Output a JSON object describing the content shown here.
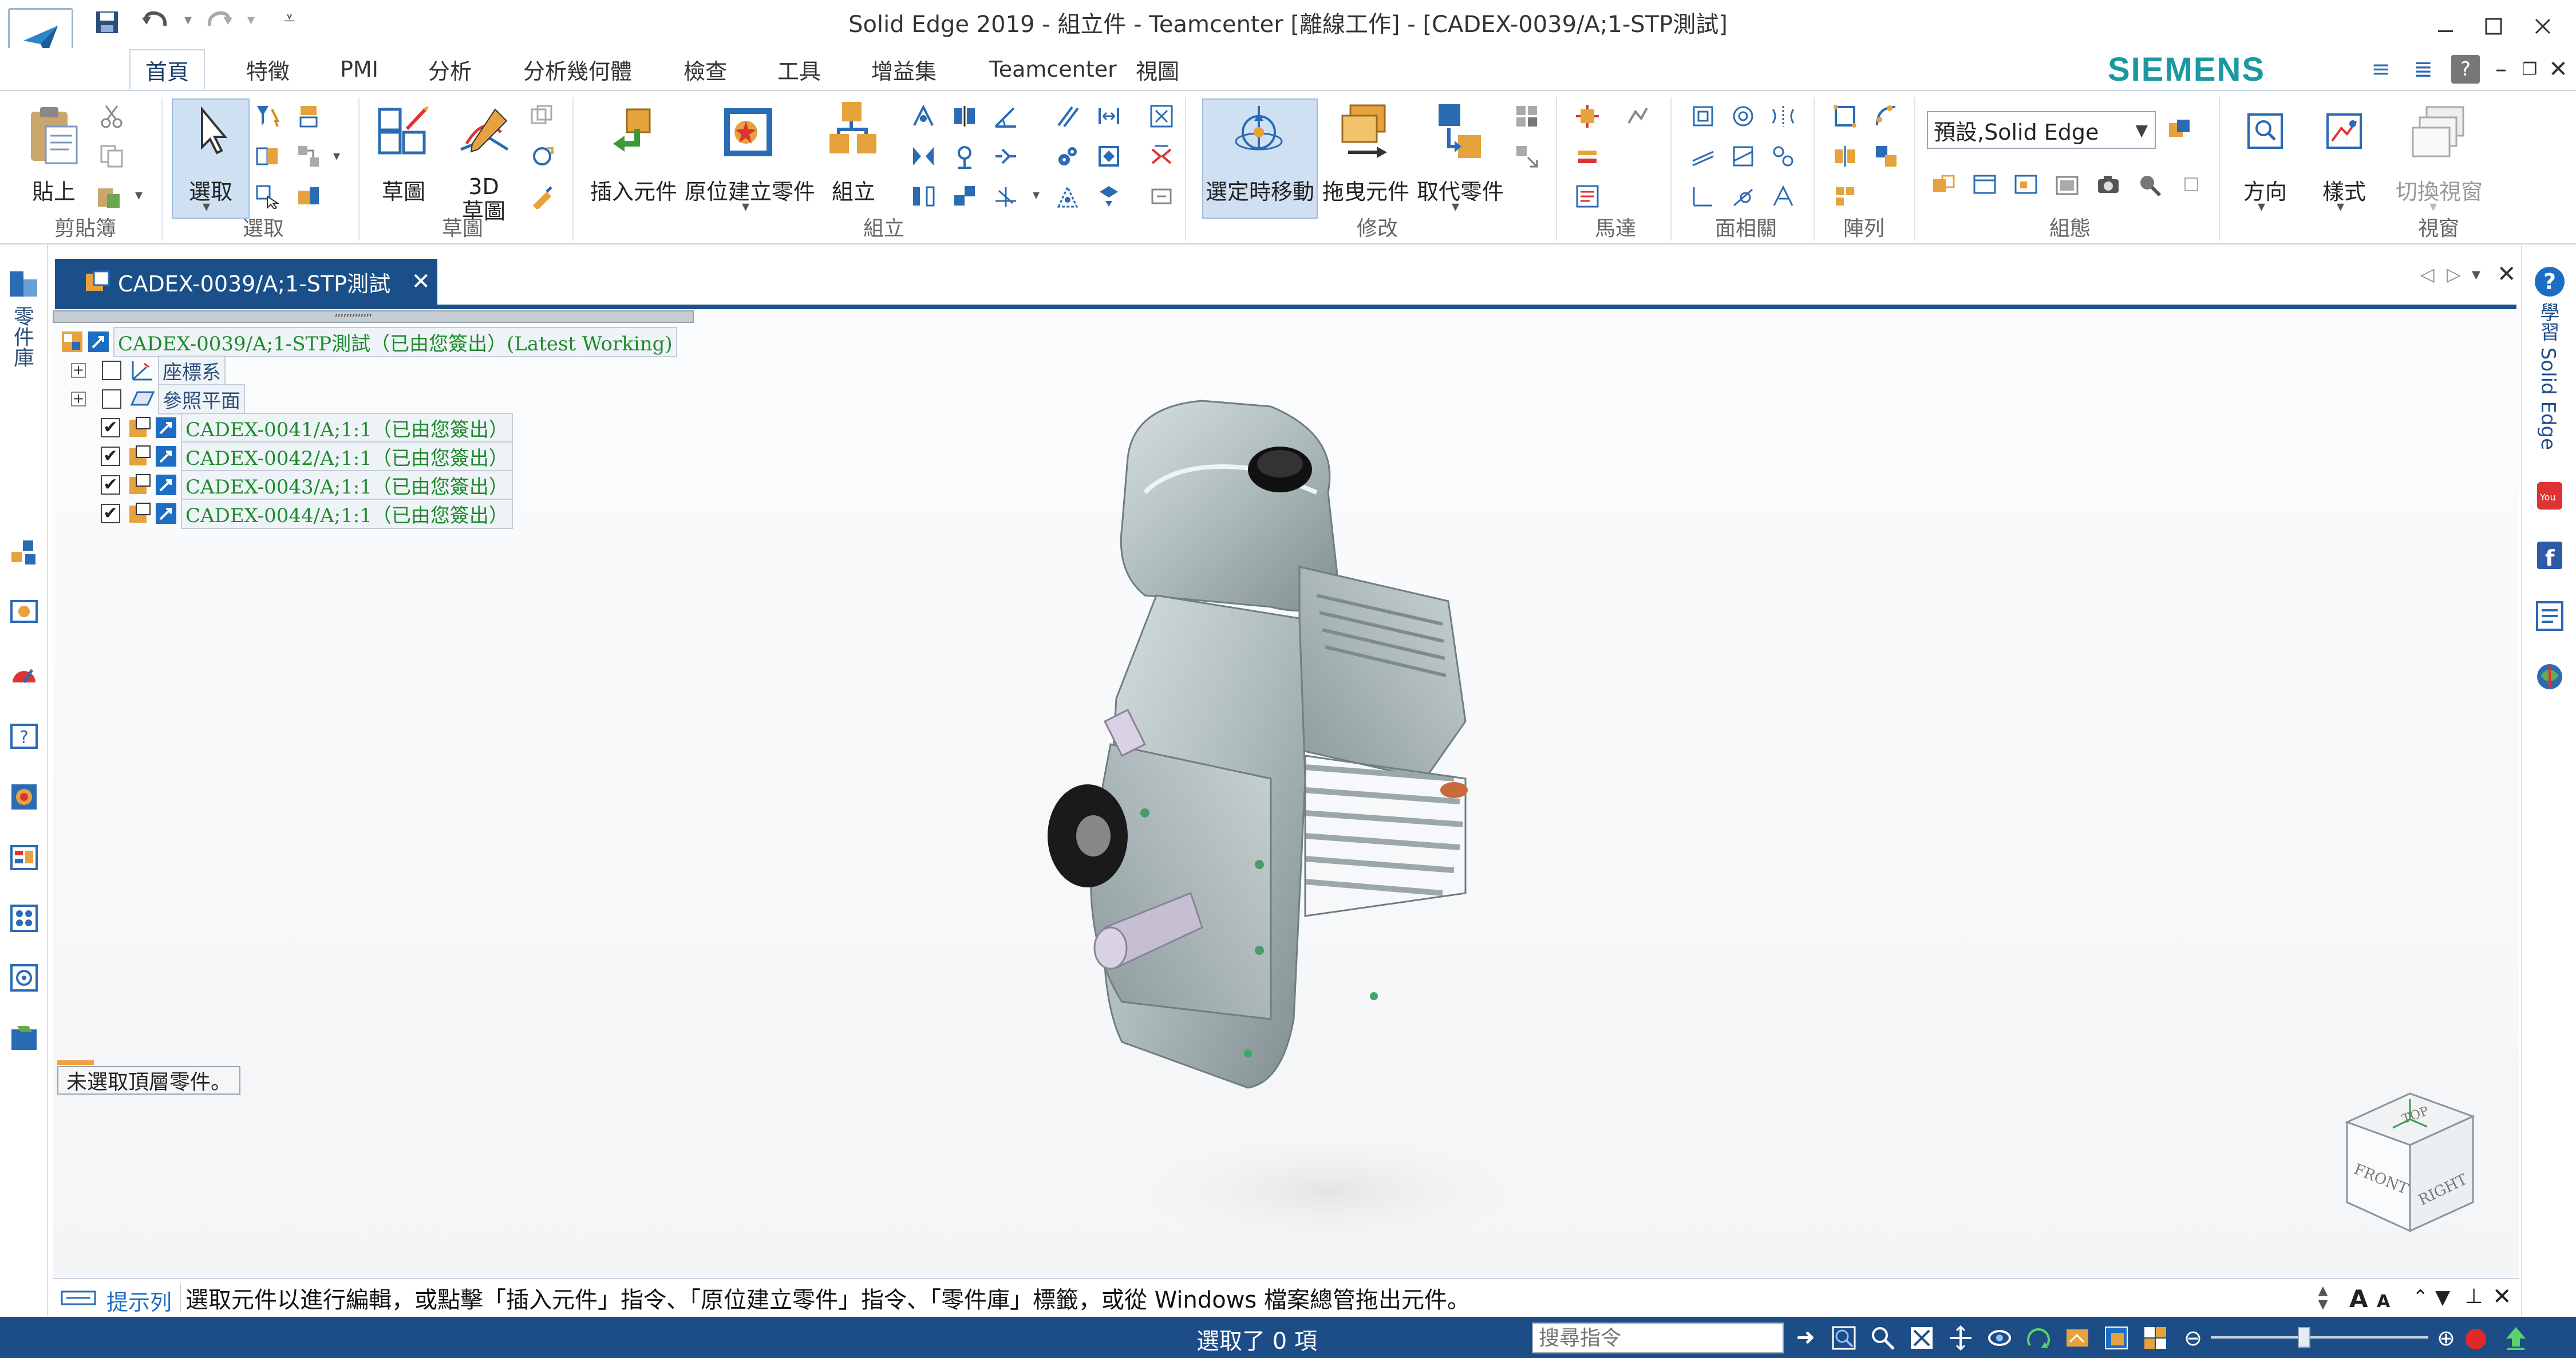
{
  "window": {
    "title": "Solid Edge 2019 - 組立件 - Teamcenter [離線工作] - [CADEX-0039/A;1-STP測試]",
    "brand": "SIEMENS",
    "accent": "#1c4d86"
  },
  "tabs": [
    "首頁",
    "特徵",
    "PMI",
    "分析",
    "分析幾何體",
    "檢查",
    "工具",
    "增益集",
    "Teamcenter",
    "視圖"
  ],
  "ribbon": {
    "groups": {
      "clipboard": "剪貼簿",
      "select": "選取",
      "sketch": "草圖",
      "assemble": "組立",
      "modify": "修改",
      "motor": "馬達",
      "face_relate": "面相關",
      "pattern": "陣列",
      "configurations": "組態",
      "view": "視窗"
    },
    "buttons": {
      "paste": "貼上",
      "select": "選取",
      "sketch": "草圖",
      "sketch3d_top": "3D",
      "sketch3d_bottom": "草圖",
      "insert_component": "插入元件",
      "create_in_place": "原位建立零件",
      "assemble": "組立",
      "move_on_select": "選定時移動",
      "drag_component": "拖曳元件",
      "replace_part": "取代零件",
      "orientation": "方向",
      "styles": "樣式",
      "switch_windows": "切換視窗"
    },
    "config_select": "預設,Solid Edge"
  },
  "left_rail": {
    "label": "零件庫"
  },
  "right_rail": {
    "label": "學習 Solid Edge"
  },
  "document": {
    "tab_title": "CADEX-0039/A;1-STP測試"
  },
  "tree": {
    "root": "CADEX-0039/A;1-STP測試（已由您簽出）(Latest Working)",
    "nodes": [
      {
        "label": "座標系",
        "checked": false
      },
      {
        "label": "參照平面",
        "checked": false
      }
    ],
    "parts": [
      {
        "label": "CADEX-0041/A;1:1（已由您簽出）",
        "checked": true
      },
      {
        "label": "CADEX-0042/A;1:1（已由您簽出）",
        "checked": true
      },
      {
        "label": "CADEX-0043/A;1:1（已由您簽出）",
        "checked": true
      },
      {
        "label": "CADEX-0044/A;1:1（已由您簽出）",
        "checked": true
      }
    ]
  },
  "notice": "未選取頂層零件。",
  "view_cube": {
    "top": "TOP",
    "front": "FRONT",
    "right": "RIGHT"
  },
  "prompt": {
    "label": "提示列",
    "text": "選取元件以進行編輯，或點擊「插入元件」指令、「原位建立零件」指令、「零件庫」標籤，或從 Windows 檔案總管拖出元件。"
  },
  "status": {
    "selection": "選取了 0 項",
    "search_placeholder": "搜尋指令"
  }
}
